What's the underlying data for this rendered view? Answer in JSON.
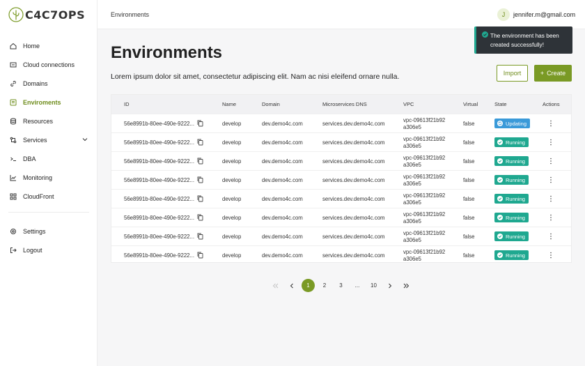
{
  "brand": {
    "name": "C4C7OPS"
  },
  "sidebar": {
    "items": [
      {
        "label": "Home",
        "icon": "home-icon"
      },
      {
        "label": "Cloud connections",
        "icon": "cloud-connection-icon"
      },
      {
        "label": "Domains",
        "icon": "link-icon"
      },
      {
        "label": "Enviroments",
        "icon": "environments-icon",
        "active": true
      },
      {
        "label": "Resources",
        "icon": "database-icon"
      },
      {
        "label": "Services",
        "icon": "services-icon",
        "expandable": true
      },
      {
        "label": "DBA",
        "icon": "terminal-icon"
      },
      {
        "label": "Monitoring",
        "icon": "chart-icon"
      },
      {
        "label": "CloudFront",
        "icon": "cloudfront-icon"
      }
    ],
    "bottom_items": [
      {
        "label": "Settings",
        "icon": "gear-icon"
      },
      {
        "label": "Logout",
        "icon": "logout-icon"
      }
    ]
  },
  "header": {
    "breadcrumb": "Environments",
    "user": {
      "initial": "J",
      "email": "jennifer.m@gmail.com"
    }
  },
  "toast": {
    "message": "The environment has been created successfully!"
  },
  "page": {
    "title": "Environments",
    "description": "Lorem ipsum dolor sit amet, consectetur adipiscing elit. Nam ac nisi eleifend ornare nulla.",
    "import_label": "Import",
    "create_label": "Create"
  },
  "table": {
    "columns": [
      "ID",
      "Name",
      "Domain",
      "Microservices DNS",
      "VPC",
      "Virtual",
      "State",
      "Actions"
    ],
    "rows": [
      {
        "id": "56e8991b-80ee-490e-9222...",
        "name": "develop",
        "domain": "dev.demo4c.com",
        "dns": "services.dev.demo4c.com",
        "vpc1": "vpc-09613f21b92",
        "vpc2": "a306e5",
        "virtual": "false",
        "state": "Updating"
      },
      {
        "id": "56e8991b-80ee-490e-9222...",
        "name": "develop",
        "domain": "dev.demo4c.com",
        "dns": "services.dev.demo4c.com",
        "vpc1": "vpc-09613f21b92",
        "vpc2": "a306e5",
        "virtual": "false",
        "state": "Running"
      },
      {
        "id": "56e8991b-80ee-490e-9222...",
        "name": "develop",
        "domain": "dev.demo4c.com",
        "dns": "services.dev.demo4c.com",
        "vpc1": "vpc-09613f21b92",
        "vpc2": "a306e5",
        "virtual": "false",
        "state": "Running"
      },
      {
        "id": "56e8991b-80ee-490e-9222...",
        "name": "develop",
        "domain": "dev.demo4c.com",
        "dns": "services.dev.demo4c.com",
        "vpc1": "vpc-09613f21b92",
        "vpc2": "a306e5",
        "virtual": "false",
        "state": "Running"
      },
      {
        "id": "56e8991b-80ee-490e-9222...",
        "name": "develop",
        "domain": "dev.demo4c.com",
        "dns": "services.dev.demo4c.com",
        "vpc1": "vpc-09613f21b92",
        "vpc2": "a306e5",
        "virtual": "false",
        "state": "Running"
      },
      {
        "id": "56e8991b-80ee-490e-9222...",
        "name": "develop",
        "domain": "dev.demo4c.com",
        "dns": "services.dev.demo4c.com",
        "vpc1": "vpc-09613f21b92",
        "vpc2": "a306e5",
        "virtual": "false",
        "state": "Running"
      },
      {
        "id": "56e8991b-80ee-490e-9222...",
        "name": "develop",
        "domain": "dev.demo4c.com",
        "dns": "services.dev.demo4c.com",
        "vpc1": "vpc-09613f21b92",
        "vpc2": "a306e5",
        "virtual": "false",
        "state": "Running"
      },
      {
        "id": "56e8991b-80ee-490e-9222...",
        "name": "develop",
        "domain": "dev.demo4c.com",
        "dns": "services.dev.demo4c.com",
        "vpc1": "vpc-09613f21b92",
        "vpc2": "a306e5",
        "virtual": "false",
        "state": "Running"
      }
    ]
  },
  "pagination": {
    "pages": [
      "1",
      "2",
      "3",
      "...",
      "10"
    ],
    "current": "1"
  },
  "colors": {
    "accent": "#7a9a25",
    "updating": "#3a9ad9",
    "running": "#1fa890",
    "toast_bg": "#2e3338"
  }
}
